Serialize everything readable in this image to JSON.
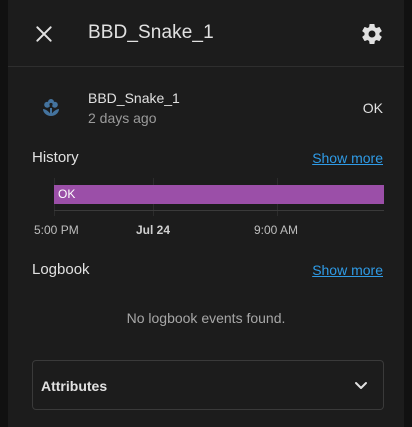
{
  "dialog": {
    "title": "BBD_Snake_1",
    "close_icon": "close-icon",
    "settings_icon": "gear-icon"
  },
  "entity": {
    "icon": "flower-icon",
    "icon_color": "#44739e",
    "name": "BBD_Snake_1",
    "last_changed": "2 days ago",
    "state": "OK"
  },
  "history": {
    "title": "History",
    "show_more": "Show more",
    "bar_state": "OK",
    "bar_color": "#9b4fa8",
    "ticks": [
      "5:00 PM",
      "Jul 24",
      "9:00 AM"
    ]
  },
  "logbook": {
    "title": "Logbook",
    "show_more": "Show more",
    "empty_message": "No logbook events found."
  },
  "attributes": {
    "label": "Attributes",
    "expand_icon": "chevron-down-icon"
  },
  "colors": {
    "accent": "#2f9be6",
    "surface": "#1c1c1c",
    "text": "#e1e1e1"
  }
}
